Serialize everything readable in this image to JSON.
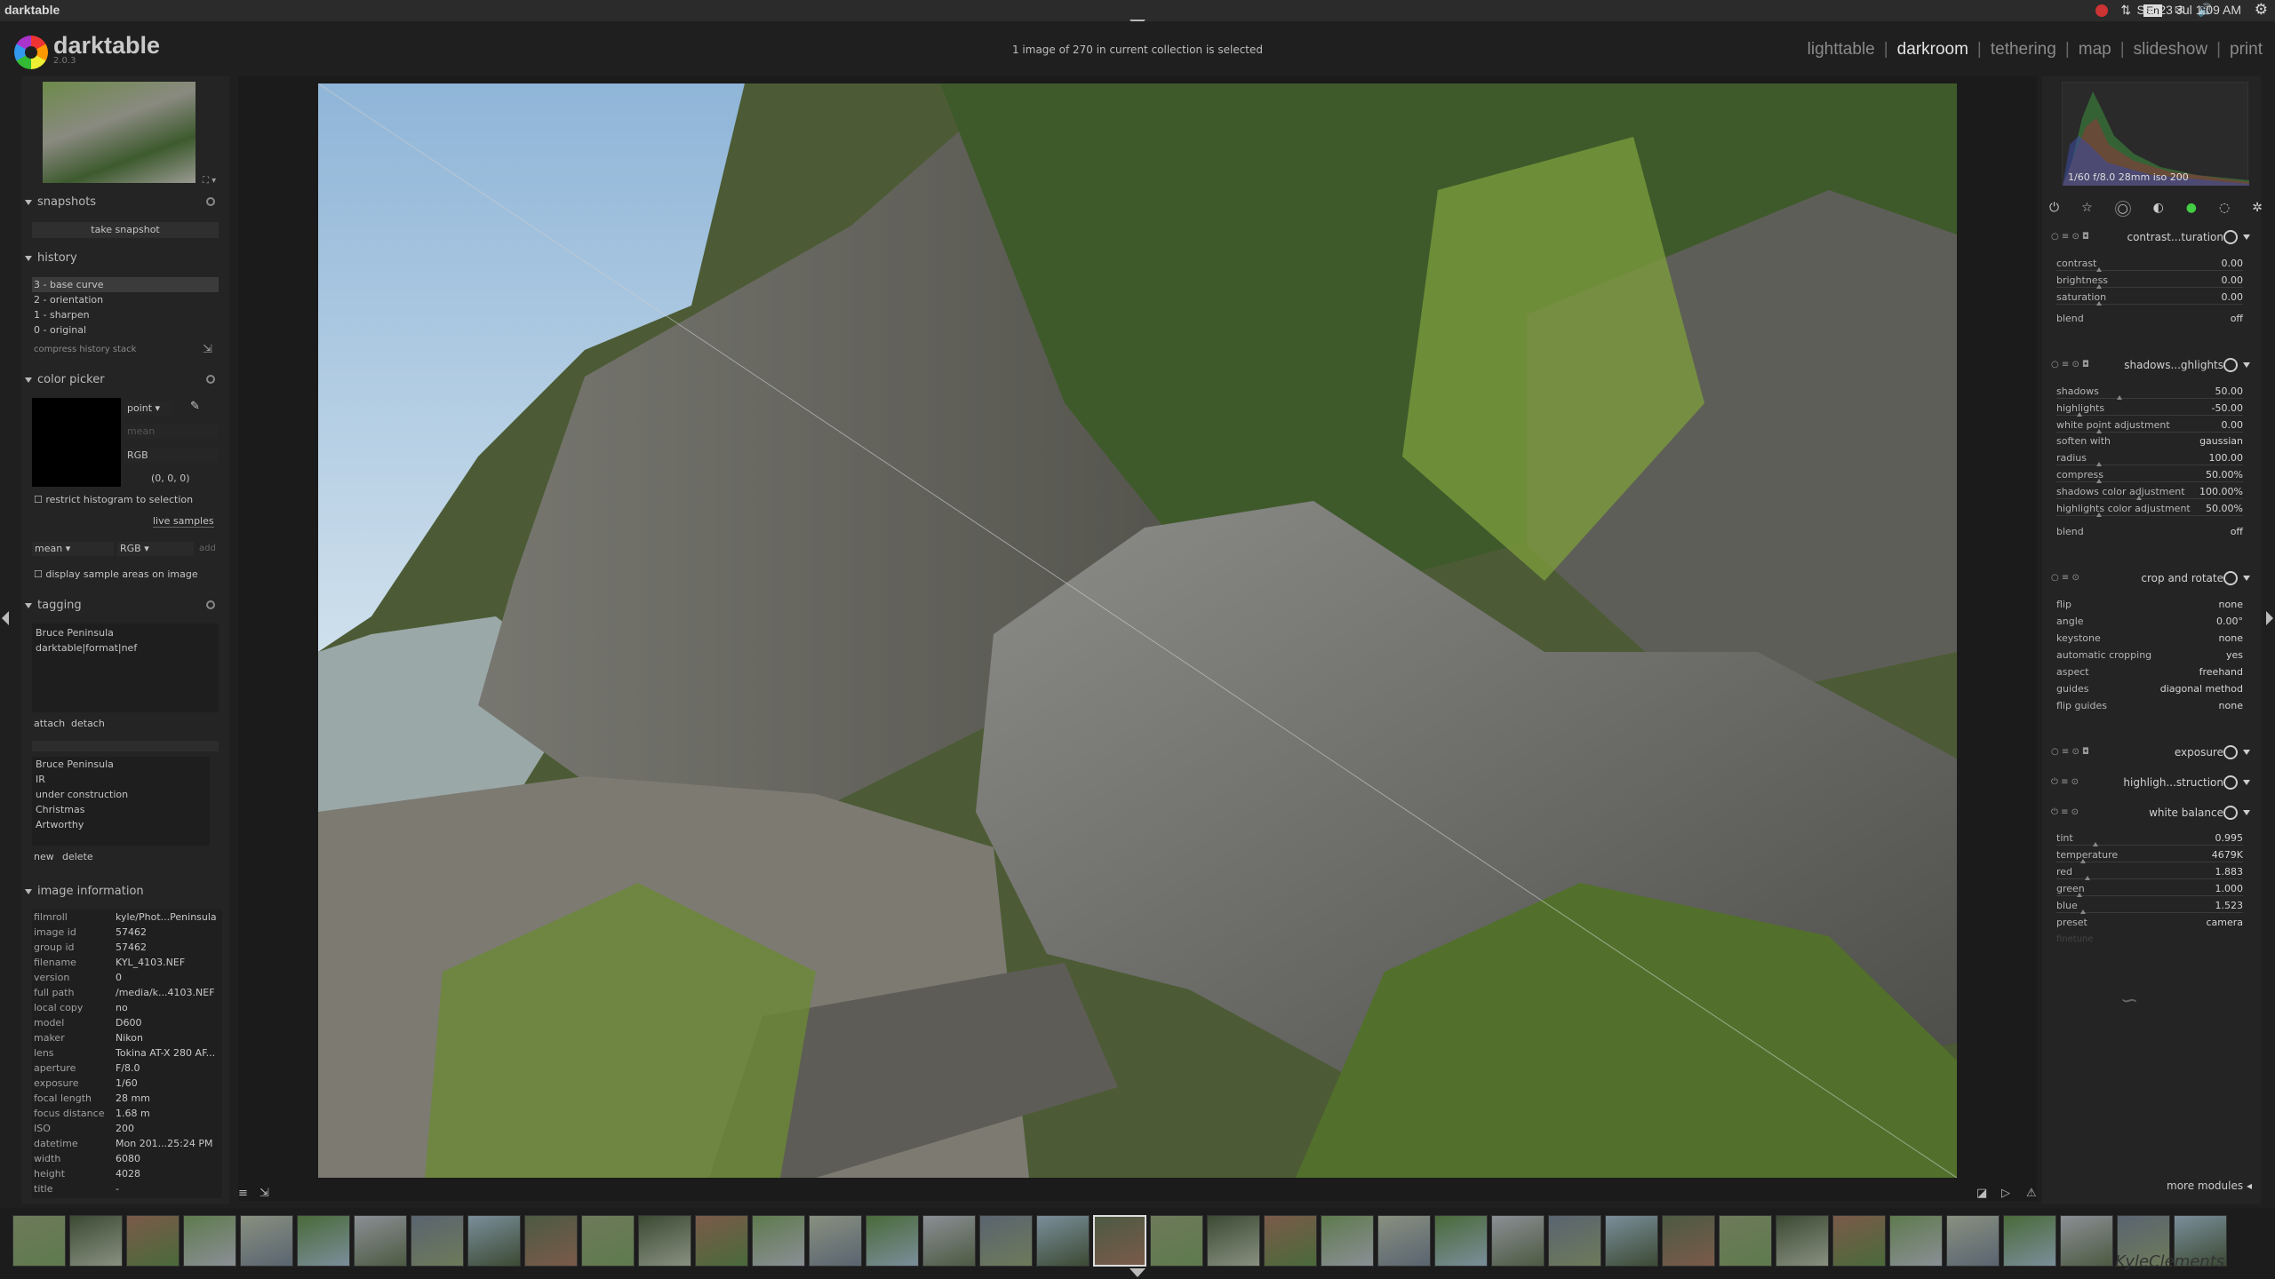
{
  "system": {
    "app_title": "darktable",
    "clock": "Sat 23 Jul  1:09 AM",
    "kbd": "En"
  },
  "header": {
    "app_name": "darktable",
    "version": "2.0.3",
    "collection_info": "1 image of 270 in current collection is selected",
    "views": [
      "lighttable",
      "darkroom",
      "tethering",
      "map",
      "slideshow",
      "print"
    ],
    "active_view": "darkroom"
  },
  "snapshots": {
    "title": "snapshots",
    "take": "take snapshot"
  },
  "history": {
    "title": "history",
    "items": [
      "3 - base curve",
      "2 - orientation",
      "1 - sharpen",
      "0 - original"
    ],
    "compress": "compress history stack"
  },
  "color_picker": {
    "title": "color picker",
    "mode": "point",
    "stat": "mean",
    "space": "RGB",
    "value": "(0, 0, 0)",
    "restrict": "restrict histogram to selection",
    "live": "live samples",
    "mean2": "mean",
    "rgb2": "RGB",
    "add": "add",
    "display_areas": "display sample areas on image"
  },
  "tagging": {
    "title": "tagging",
    "attached": [
      "Bruce Peninsula",
      "darktable|format|nef"
    ],
    "attach": "attach",
    "detach": "detach",
    "dictionary": [
      "Bruce Peninsula",
      "IR",
      "under construction",
      "Christmas",
      "Artworthy"
    ],
    "new": "new",
    "delete": "delete"
  },
  "image_info": {
    "title": "image information",
    "rows": [
      [
        "filmroll",
        "kyle/Phot...Peninsula"
      ],
      [
        "image id",
        "57462"
      ],
      [
        "group id",
        "57462"
      ],
      [
        "filename",
        "KYL_4103.NEF"
      ],
      [
        "version",
        "0"
      ],
      [
        "full path",
        "/media/k...4103.NEF"
      ],
      [
        "local copy",
        "no"
      ],
      [
        "model",
        "D600"
      ],
      [
        "maker",
        "Nikon"
      ],
      [
        "lens",
        "Tokina AT-X 280 AF..."
      ],
      [
        "aperture",
        "F/8.0"
      ],
      [
        "exposure",
        "1/60"
      ],
      [
        "focal length",
        "28 mm"
      ],
      [
        "focus distance",
        "1.68 m"
      ],
      [
        "ISO",
        "200"
      ],
      [
        "datetime",
        "Mon 201...25:24 PM"
      ],
      [
        "width",
        "6080"
      ],
      [
        "height",
        "4028"
      ],
      [
        "title",
        "-"
      ]
    ]
  },
  "histogram": {
    "caption": "1/60 f/8.0 28mm iso 200"
  },
  "modules": {
    "contrast": {
      "name": "contrast...turation",
      "rows": [
        [
          "contrast",
          "0.00",
          0.5
        ],
        [
          "brightness",
          "0.00",
          0.5
        ],
        [
          "saturation",
          "0.00",
          0.5
        ]
      ],
      "blend": [
        "blend",
        "off"
      ]
    },
    "shadows": {
      "name": "shadows...ghlights",
      "rows": [
        [
          "shadows",
          "50.00",
          0.75
        ],
        [
          "highlights",
          "-50.00",
          0.25
        ],
        [
          "white point adjustment",
          "0.00",
          0.5
        ]
      ],
      "soften": [
        "soften with",
        "gaussian"
      ],
      "rows2": [
        [
          "radius",
          "100.00",
          0.5
        ],
        [
          "compress",
          "50.00%",
          0.5
        ],
        [
          "shadows color adjustment",
          "100.00%",
          1.0
        ],
        [
          "highlights color adjustment",
          "50.00%",
          0.5
        ]
      ],
      "blend": [
        "blend",
        "off"
      ]
    },
    "crop": {
      "name": "crop and rotate",
      "rows": [
        [
          "flip",
          "none"
        ],
        [
          "angle",
          "0.00°"
        ],
        [
          "keystone",
          "none"
        ],
        [
          "automatic cropping",
          "yes"
        ],
        [
          "aspect",
          "freehand"
        ],
        [
          "guides",
          "diagonal method"
        ],
        [
          "flip guides",
          "none"
        ]
      ]
    },
    "exposure": {
      "name": "exposure"
    },
    "highlight": {
      "name": "highligh...struction"
    },
    "wb": {
      "name": "white balance",
      "rows": [
        [
          "tint",
          "0.995",
          0.45
        ],
        [
          "temperature",
          "4679K",
          0.3
        ],
        [
          "red",
          "1.883",
          0.35
        ],
        [
          "green",
          "1.000",
          0.25
        ],
        [
          "blue",
          "1.523",
          0.3
        ]
      ],
      "preset": [
        "preset",
        "camera"
      ],
      "finetune": "finetune"
    }
  },
  "more_modules": "more modules",
  "filmstrip": {
    "count": 39,
    "watermark": "KyleClements"
  }
}
